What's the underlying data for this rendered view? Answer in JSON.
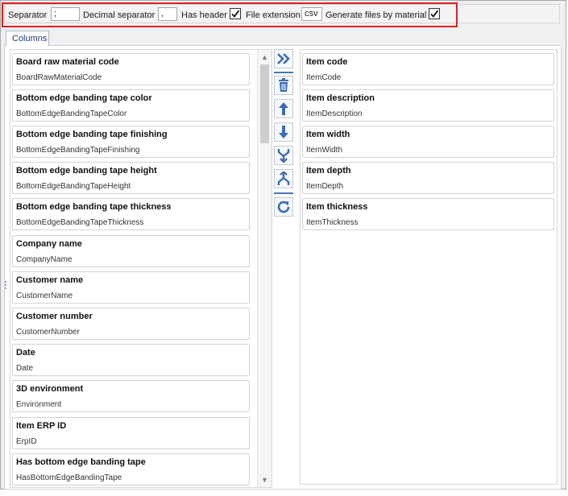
{
  "toolbar": {
    "separator_label": "Separator",
    "separator_value": ";",
    "decimal_separator_label": "Decimal separator",
    "decimal_separator_value": ",",
    "has_header_label": "Has header",
    "has_header_checked": true,
    "file_extension_label": "File extension",
    "file_extension_value": "csv",
    "generate_files_label": "Generate files by material",
    "generate_files_checked": true
  },
  "tabs": [
    {
      "label": "Columns",
      "active": true
    }
  ],
  "available_columns": [
    {
      "title": "Board raw material code",
      "key": "BoardRawMaterialCode"
    },
    {
      "title": "Bottom edge banding tape color",
      "key": "BottomEdgeBandingTapeColor"
    },
    {
      "title": "Bottom edge banding tape finishing",
      "key": "BottomEdgeBandingTapeFinishing"
    },
    {
      "title": "Bottom edge banding tape height",
      "key": "BottomEdgeBandingTapeHeight"
    },
    {
      "title": "Bottom edge banding tape thickness",
      "key": "BottomEdgeBandingTapeThickness"
    },
    {
      "title": "Company name",
      "key": "CompanyName"
    },
    {
      "title": "Customer name",
      "key": "CustomerName"
    },
    {
      "title": "Customer number",
      "key": "CustomerNumber"
    },
    {
      "title": "Date",
      "key": "Date"
    },
    {
      "title": "3D environment",
      "key": "Environment"
    },
    {
      "title": "Item ERP ID",
      "key": "ErpID"
    },
    {
      "title": "Has bottom edge banding tape",
      "key": "HasBottomEdgeBandingTape"
    }
  ],
  "selected_columns": [
    {
      "title": "Item code",
      "key": "ItemCode"
    },
    {
      "title": "Item description",
      "key": "ItemDescription"
    },
    {
      "title": "Item width",
      "key": "ItemWidth"
    },
    {
      "title": "Item depth",
      "key": "ItemDepth"
    },
    {
      "title": "Item thickness",
      "key": "ItemThickness"
    }
  ],
  "action_icons": [
    "add-all-icon",
    "delete-icon",
    "move-up-icon",
    "move-down-icon",
    "merge-icon",
    "split-icon",
    "refresh-icon"
  ],
  "colors": {
    "accent": "#3b6cb5",
    "highlight_border": "#e02020"
  }
}
